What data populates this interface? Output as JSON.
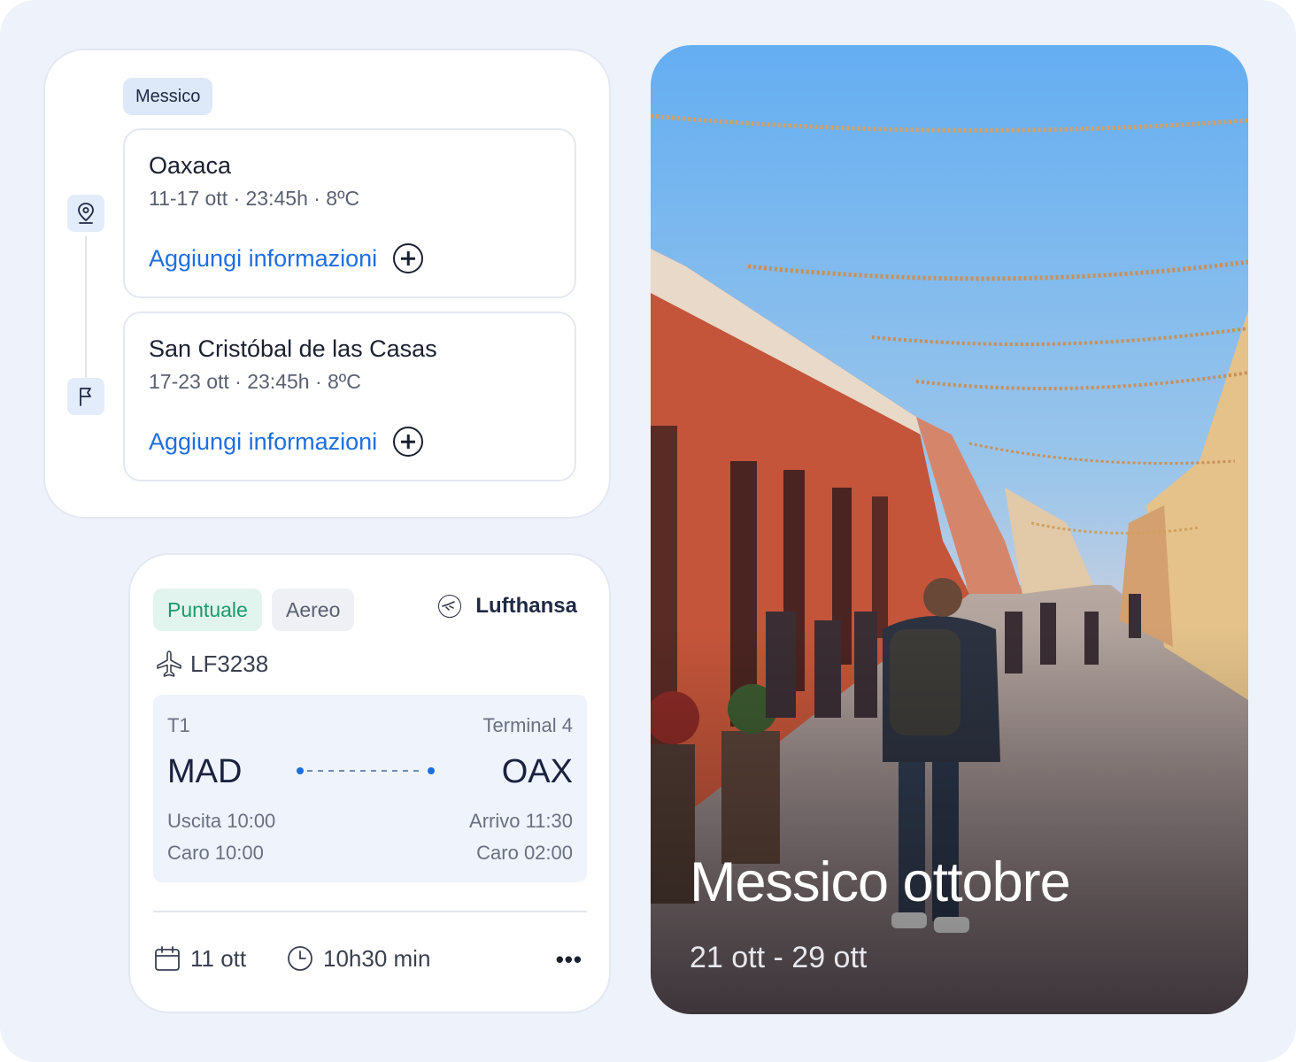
{
  "itinerary": {
    "country_chip": "Messico",
    "stops": [
      {
        "name": "Oaxaca",
        "meta": "11-17 ott · 23:45h · 8ºC",
        "add_label": "Aggiungi informazioni"
      },
      {
        "name": "San Cristóbal de las Casas",
        "meta": "17-23 ott · 23:45h · 8ºC",
        "add_label": "Aggiungi informazioni"
      }
    ],
    "icons": [
      "location-pin-icon",
      "flag-icon",
      "plus-circle-icon"
    ]
  },
  "flight": {
    "status": "Puntuale",
    "type": "Aereo",
    "airline": "Lufthansa",
    "number": "LF3238",
    "origin": {
      "terminal": "T1",
      "code": "MAD",
      "time_label": "Uscita 10:00",
      "price_label": "Caro 10:00"
    },
    "destination": {
      "terminal": "Terminal 4",
      "code": "OAX",
      "time_label": "Arrivo 11:30",
      "price_label": "Caro 02:00"
    },
    "date": "11 ott",
    "duration": "10h30 min",
    "more": "•••",
    "colors": {
      "status_text": "#1a9a6c",
      "status_bg": "#e1f4ee",
      "accent": "#1d6fe0"
    },
    "icons": [
      "airline-logo-icon",
      "plane-icon",
      "calendar-icon",
      "clock-icon",
      "more-icon"
    ]
  },
  "trip": {
    "title": "Messico ottobre",
    "dates": "21 ott - 29 ott"
  }
}
